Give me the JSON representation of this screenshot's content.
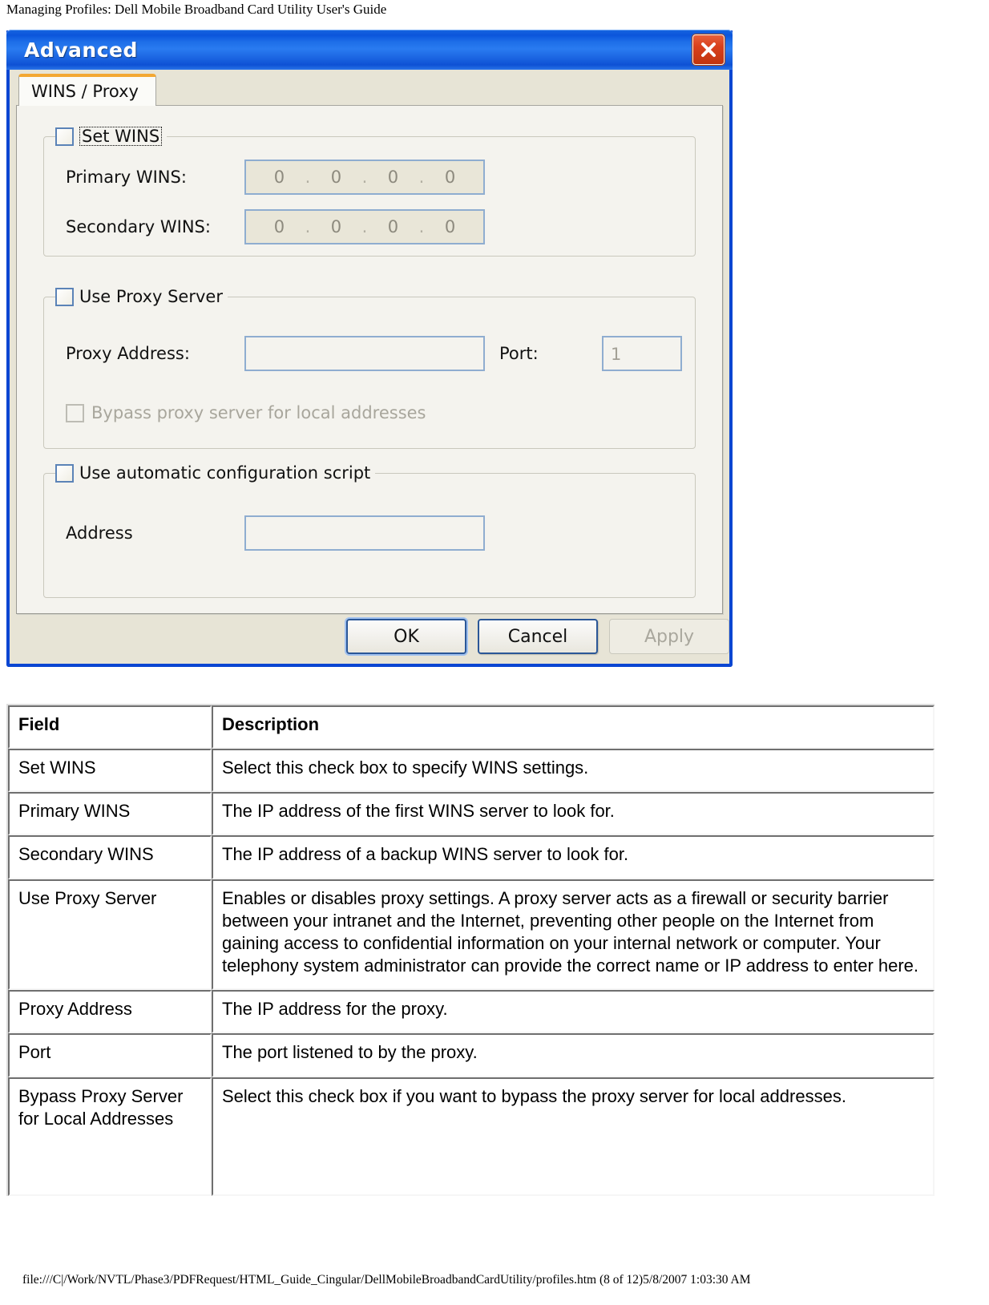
{
  "page": {
    "header": "Managing Profiles: Dell Mobile Broadband Card Utility User's Guide",
    "footer": "file:///C|/Work/NVTL/Phase3/PDFRequest/HTML_Guide_Cingular/DellMobileBroadbandCardUtility/profiles.htm (8 of 12)5/8/2007 1:03:30 AM"
  },
  "dialog": {
    "title": "Advanced",
    "close_icon": "close-icon",
    "tab": {
      "label": "WINS / Proxy"
    },
    "wins_group": {
      "checkbox_label": "Set WINS",
      "primary_label": "Primary WINS:",
      "primary_value": [
        "0",
        "0",
        "0",
        "0"
      ],
      "secondary_label": "Secondary WINS:",
      "secondary_value": [
        "0",
        "0",
        "0",
        "0"
      ],
      "ip_separator": "."
    },
    "proxy_group": {
      "checkbox_label": "Use Proxy Server",
      "address_label": "Proxy Address:",
      "address_value": "",
      "port_label": "Port:",
      "port_value": "1",
      "bypass_label": "Bypass proxy server for local addresses"
    },
    "script_group": {
      "checkbox_label": "Use automatic configuration script",
      "address_label": "Address",
      "address_value": ""
    },
    "buttons": {
      "ok": "OK",
      "cancel": "Cancel",
      "apply": "Apply"
    },
    "colors": {
      "titlebar_blue": "#0b55db",
      "window_border": "#0a46d2",
      "tab_accent": "#f3a833",
      "close_red": "#d8401c",
      "face": "#e7e4d6"
    }
  },
  "table": {
    "headers": [
      "Field",
      "Description"
    ],
    "rows": [
      {
        "field": "Set WINS",
        "description": "Select this check box to specify WINS settings."
      },
      {
        "field": "Primary WINS",
        "description": "The IP address of the first WINS server to look for."
      },
      {
        "field": "Secondary WINS",
        "description": "The IP address of a backup WINS server to look for."
      },
      {
        "field": "Use Proxy Server",
        "description": "Enables or disables proxy settings. A proxy server acts as a firewall or security barrier between your intranet and the Internet, preventing other people on the Internet from gaining access to confidential information on your internal network or computer. Your telephony system administrator can provide the correct name or IP address to enter here."
      },
      {
        "field": "Proxy Address",
        "description": "The IP address for the proxy."
      },
      {
        "field": "Port",
        "description": "The port listened to by the proxy."
      },
      {
        "field": "Bypass Proxy Server for Local Addresses",
        "description": "Select this check box if you want to bypass the proxy server for local addresses."
      }
    ]
  }
}
